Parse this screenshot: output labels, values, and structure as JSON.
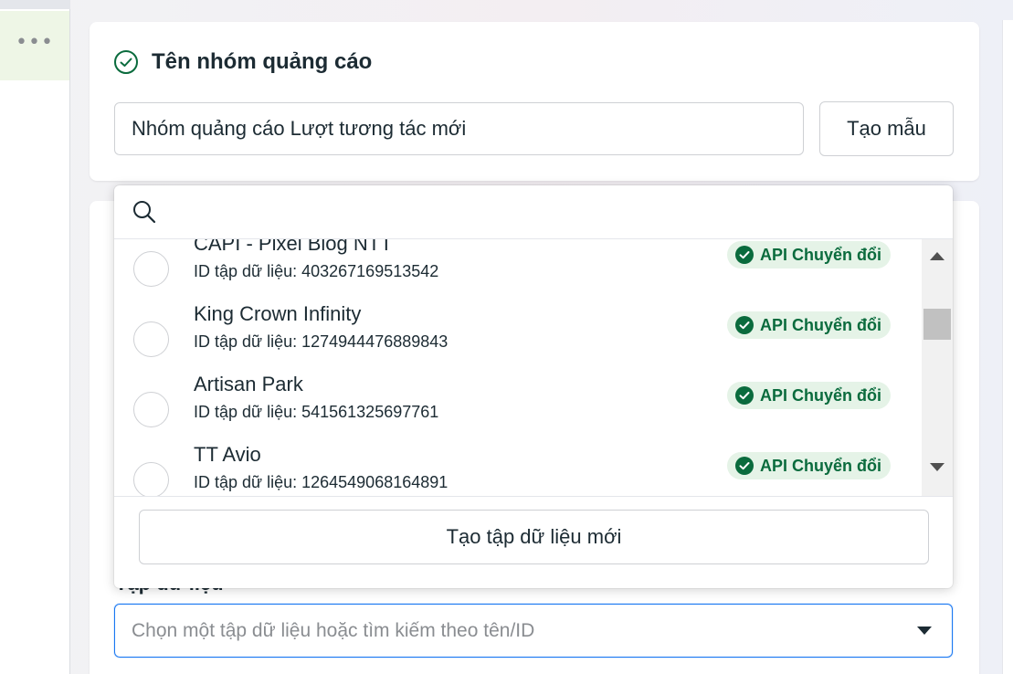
{
  "more_menu": {
    "glyph": "•••"
  },
  "ad_set_name": {
    "title": "Tên nhóm quảng cáo",
    "input_value": "Nhóm quảng cáo Lượt tương tác mới",
    "template_button": "Tạo mẫu"
  },
  "dataset": {
    "label": "Tập dữ liệu",
    "select_placeholder": "Chọn một tập dữ liệu hoặc tìm kiếm theo tên/ID",
    "dropdown": {
      "search_placeholder": "",
      "items": [
        {
          "name": "CAPI - Pixel Blog NTT",
          "meta": "ID tập dữ liệu: 403267169513542",
          "badge": "API Chuyển đổi"
        },
        {
          "name": "King Crown Infinity",
          "meta": "ID tập dữ liệu: 1274944476889843",
          "badge": "API Chuyển đổi"
        },
        {
          "name": "Artisan Park",
          "meta": "ID tập dữ liệu: 541561325697761",
          "badge": "API Chuyển đổi"
        },
        {
          "name": "TT Avio",
          "meta": "ID tập dữ liệu: 1264549068164891",
          "badge": "API Chuyển đổi"
        }
      ],
      "create_button": "Tạo tập dữ liệu mới"
    }
  },
  "colors": {
    "badge_bg": "#e5f3e7",
    "badge_text": "#0a6b3d",
    "focus_border": "#1877f2",
    "text": "#1c2b33"
  }
}
